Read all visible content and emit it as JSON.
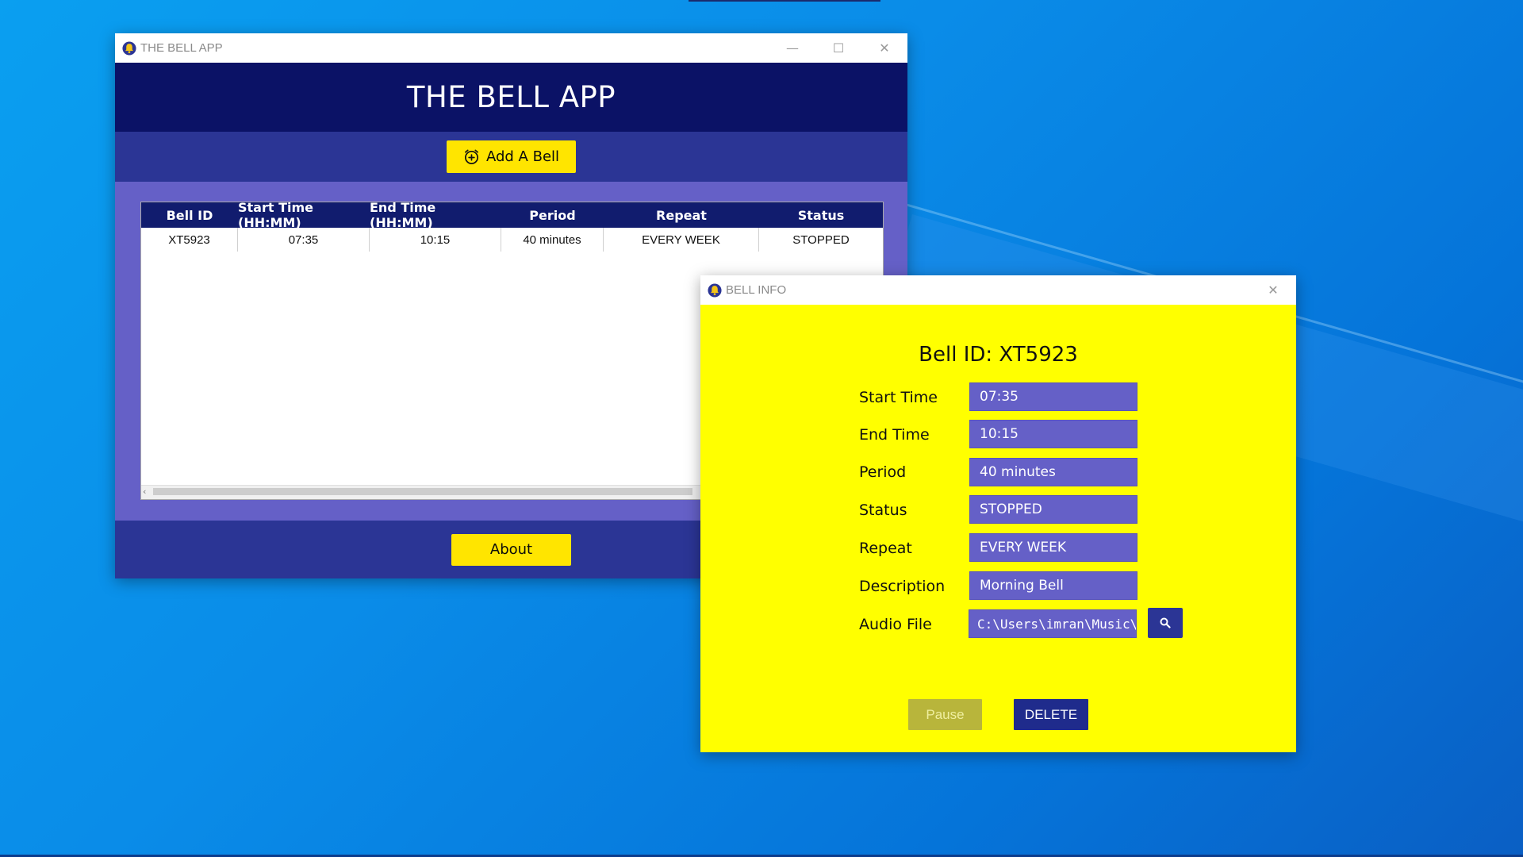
{
  "main_window": {
    "title": "THE BELL APP",
    "header_title": "THE BELL APP",
    "add_bell_label": "Add A Bell",
    "about_label": "About",
    "table": {
      "columns": [
        "Bell ID",
        "Start Time (HH:MM)",
        "End Time (HH:MM)",
        "Period",
        "Repeat",
        "Status"
      ],
      "rows": [
        [
          "XT5923",
          "07:35",
          "10:15",
          "40 minutes",
          "EVERY WEEK",
          "STOPPED"
        ]
      ]
    }
  },
  "bell_info_window": {
    "title": "BELL INFO",
    "heading": "Bell ID: XT5923",
    "fields": [
      {
        "label": "Start Time",
        "value": "07:35"
      },
      {
        "label": "End Time",
        "value": "10:15"
      },
      {
        "label": "Period",
        "value": "40 minutes"
      },
      {
        "label": "Status",
        "value": "STOPPED"
      },
      {
        "label": "Repeat",
        "value": "EVERY WEEK"
      },
      {
        "label": "Description",
        "value": "Morning Bell"
      },
      {
        "label": "Audio File",
        "value": "C:\\Users\\imran\\Music\\A"
      }
    ],
    "pause_label": "Pause",
    "delete_label": "DELETE"
  },
  "colors": {
    "header_navy": "#0b1266",
    "band_blue": "#2b3595",
    "table_purple": "#6560c7",
    "accent_yellow": "#ffe500",
    "dialog_yellow": "#ffff00"
  },
  "icons": {
    "app": "bell-icon",
    "add_bell": "alarm-clock-plus-icon",
    "browse": "search-icon",
    "minimize": "minimize-icon",
    "maximize": "maximize-icon",
    "close": "close-icon"
  }
}
